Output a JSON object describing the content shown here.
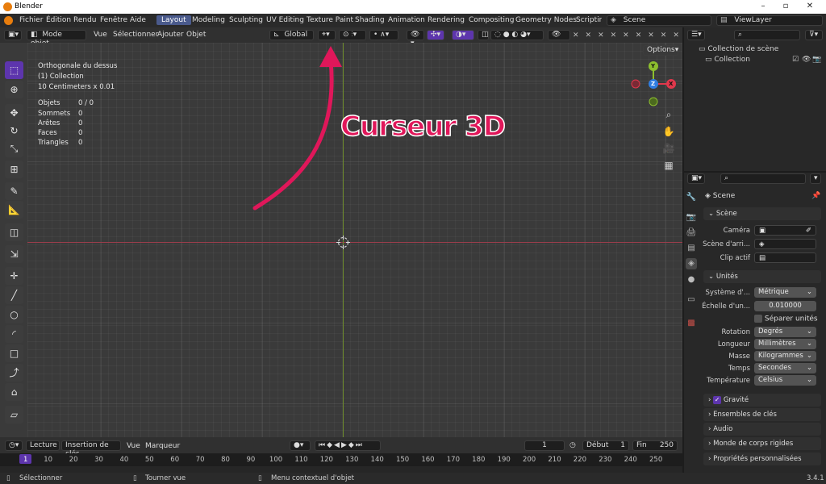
{
  "window": {
    "title": "Blender"
  },
  "menu": [
    "Fichier",
    "Édition",
    "Rendu",
    "Fenêtre",
    "Aide"
  ],
  "workspaces": [
    "Layout",
    "Modeling",
    "Sculpting",
    "UV Editing",
    "Texture Paint",
    "Shading",
    "Animation",
    "Rendering",
    "Compositing",
    "Geometry Nodes",
    "Scripting"
  ],
  "scene": {
    "name": "Scene"
  },
  "view_layer": {
    "name": "ViewLayer"
  },
  "viewport_header": {
    "mode": "Mode objet",
    "menus": [
      "Vue",
      "Sélectionner",
      "Ajouter",
      "Objet"
    ],
    "orientation": "Global",
    "options": "Options"
  },
  "overlay_text": {
    "view": "Orthogonale du dessus",
    "collection": "(1) Collection",
    "scale": "10 Centimeters x 0.01"
  },
  "stats": [
    {
      "label": "Objets",
      "value": "0 / 0"
    },
    {
      "label": "Sommets",
      "value": "0"
    },
    {
      "label": "Arêtes",
      "value": "0"
    },
    {
      "label": "Faces",
      "value": "0"
    },
    {
      "label": "Triangles",
      "value": "0"
    }
  ],
  "annotation": {
    "text": "Curseur 3D",
    "color": "#e0175a"
  },
  "gizmo": {
    "x": "X",
    "y": "Y",
    "z": "Z"
  },
  "outliner": {
    "root": "Collection de scène",
    "child": "Collection"
  },
  "properties": {
    "header": "Scene",
    "scene_section": "Scène",
    "camera_label": "Caméra",
    "background_label": "Scène d'arri...",
    "clip_label": "Clip actif",
    "units_section": "Unités",
    "unit_system_label": "Système d'...",
    "unit_system": "Métrique",
    "unit_scale_label": "Échelle d'un...",
    "unit_scale": "0.010000",
    "separate_units": "Séparer unités",
    "rotation_label": "Rotation",
    "rotation": "Degrés",
    "length_label": "Longueur",
    "length": "Millimètres",
    "mass_label": "Masse",
    "mass": "Kilogrammes",
    "time_label": "Temps",
    "time": "Secondes",
    "temperature_label": "Température",
    "temperature": "Celsius",
    "sections": [
      "Gravité",
      "Ensembles de clés",
      "Audio",
      "Monde de corps rigides",
      "Propriétés personnalisées"
    ]
  },
  "timeline": {
    "playback": "Lecture",
    "keying": "Insertion de clés",
    "view": "Vue",
    "marker": "Marqueur",
    "current_frame": "1",
    "start_label": "Début",
    "start": "1",
    "end_label": "Fin",
    "end": "250",
    "ticks": [
      "1",
      "10",
      "20",
      "30",
      "40",
      "50",
      "60",
      "70",
      "80",
      "90",
      "100",
      "110",
      "120",
      "130",
      "140",
      "150",
      "160",
      "170",
      "180",
      "190",
      "200",
      "210",
      "220",
      "230",
      "240",
      "250"
    ]
  },
  "status": {
    "select": "Sélectionner",
    "rotate": "Tourner vue",
    "context": "Menu contextuel d'objet",
    "version": "3.4.1"
  },
  "colors": {
    "accent": "#5d35ad",
    "x_axis": "#e0384c",
    "y_axis": "#8dbf2e",
    "z_axis": "#2f7de1"
  }
}
